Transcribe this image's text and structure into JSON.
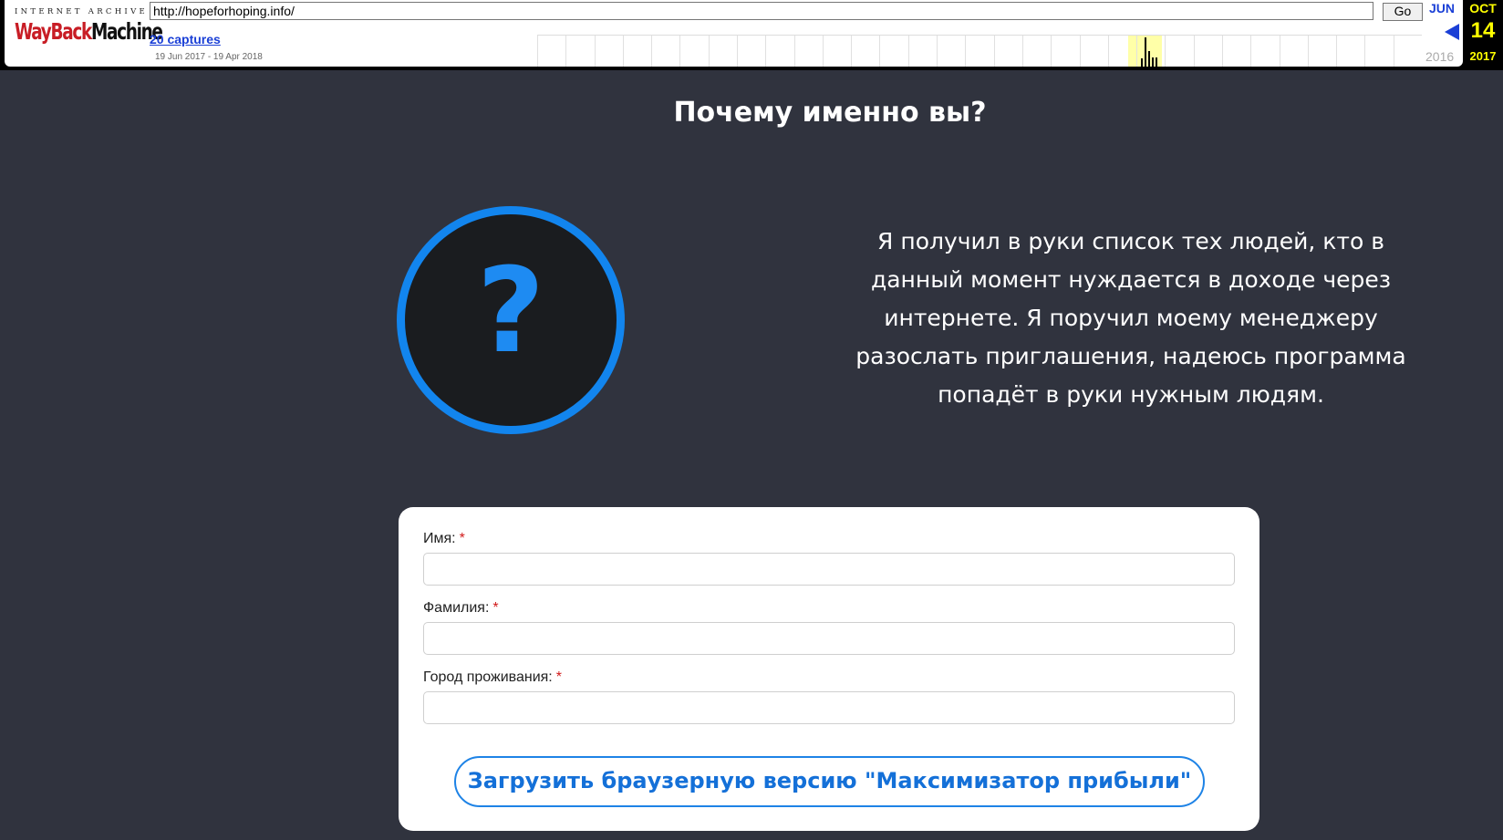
{
  "wayback": {
    "logo_top": "INTERNET ARCHIVE",
    "logo_wayback": "WayBack",
    "logo_machine": "Machine",
    "url": "http://hopeforhoping.info/",
    "go_label": "Go",
    "captures_link": "20 captures",
    "capture_range": "19 Jun 2017 - 19 Apr 2018",
    "prev_month": "JUN",
    "prev_year": "2016",
    "current_month": "OCT",
    "current_day": "14",
    "current_year": "2017",
    "sparkline_bars": [
      {
        "week": 25,
        "level": 0.25
      },
      {
        "week": 26,
        "level": 0.95
      },
      {
        "week": 27,
        "level": 0.5
      },
      {
        "week": 28,
        "level": 0.3
      },
      {
        "week": 29,
        "level": 0.3
      }
    ]
  },
  "page": {
    "title": "Почему именно вы?",
    "question_mark": "?",
    "intro": "Я получил в руки список тех людей, кто в данный момент нуждается в доходе через интернете. Я поручил моему менеджеру разослать приглашения, надеюсь программа попадёт в руки нужным людям."
  },
  "form": {
    "required_mark": "*",
    "first_name_label": "Имя:",
    "first_name_value": "",
    "last_name_label": "Фамилия:",
    "last_name_value": "",
    "city_label": "Город проживания:",
    "city_value": "",
    "submit_label": "Загрузить браузерную версию \"Максимизатор прибыли\""
  },
  "colors": {
    "background": "#30333e",
    "accent": "#1285ee",
    "required": "#d11a1a"
  }
}
